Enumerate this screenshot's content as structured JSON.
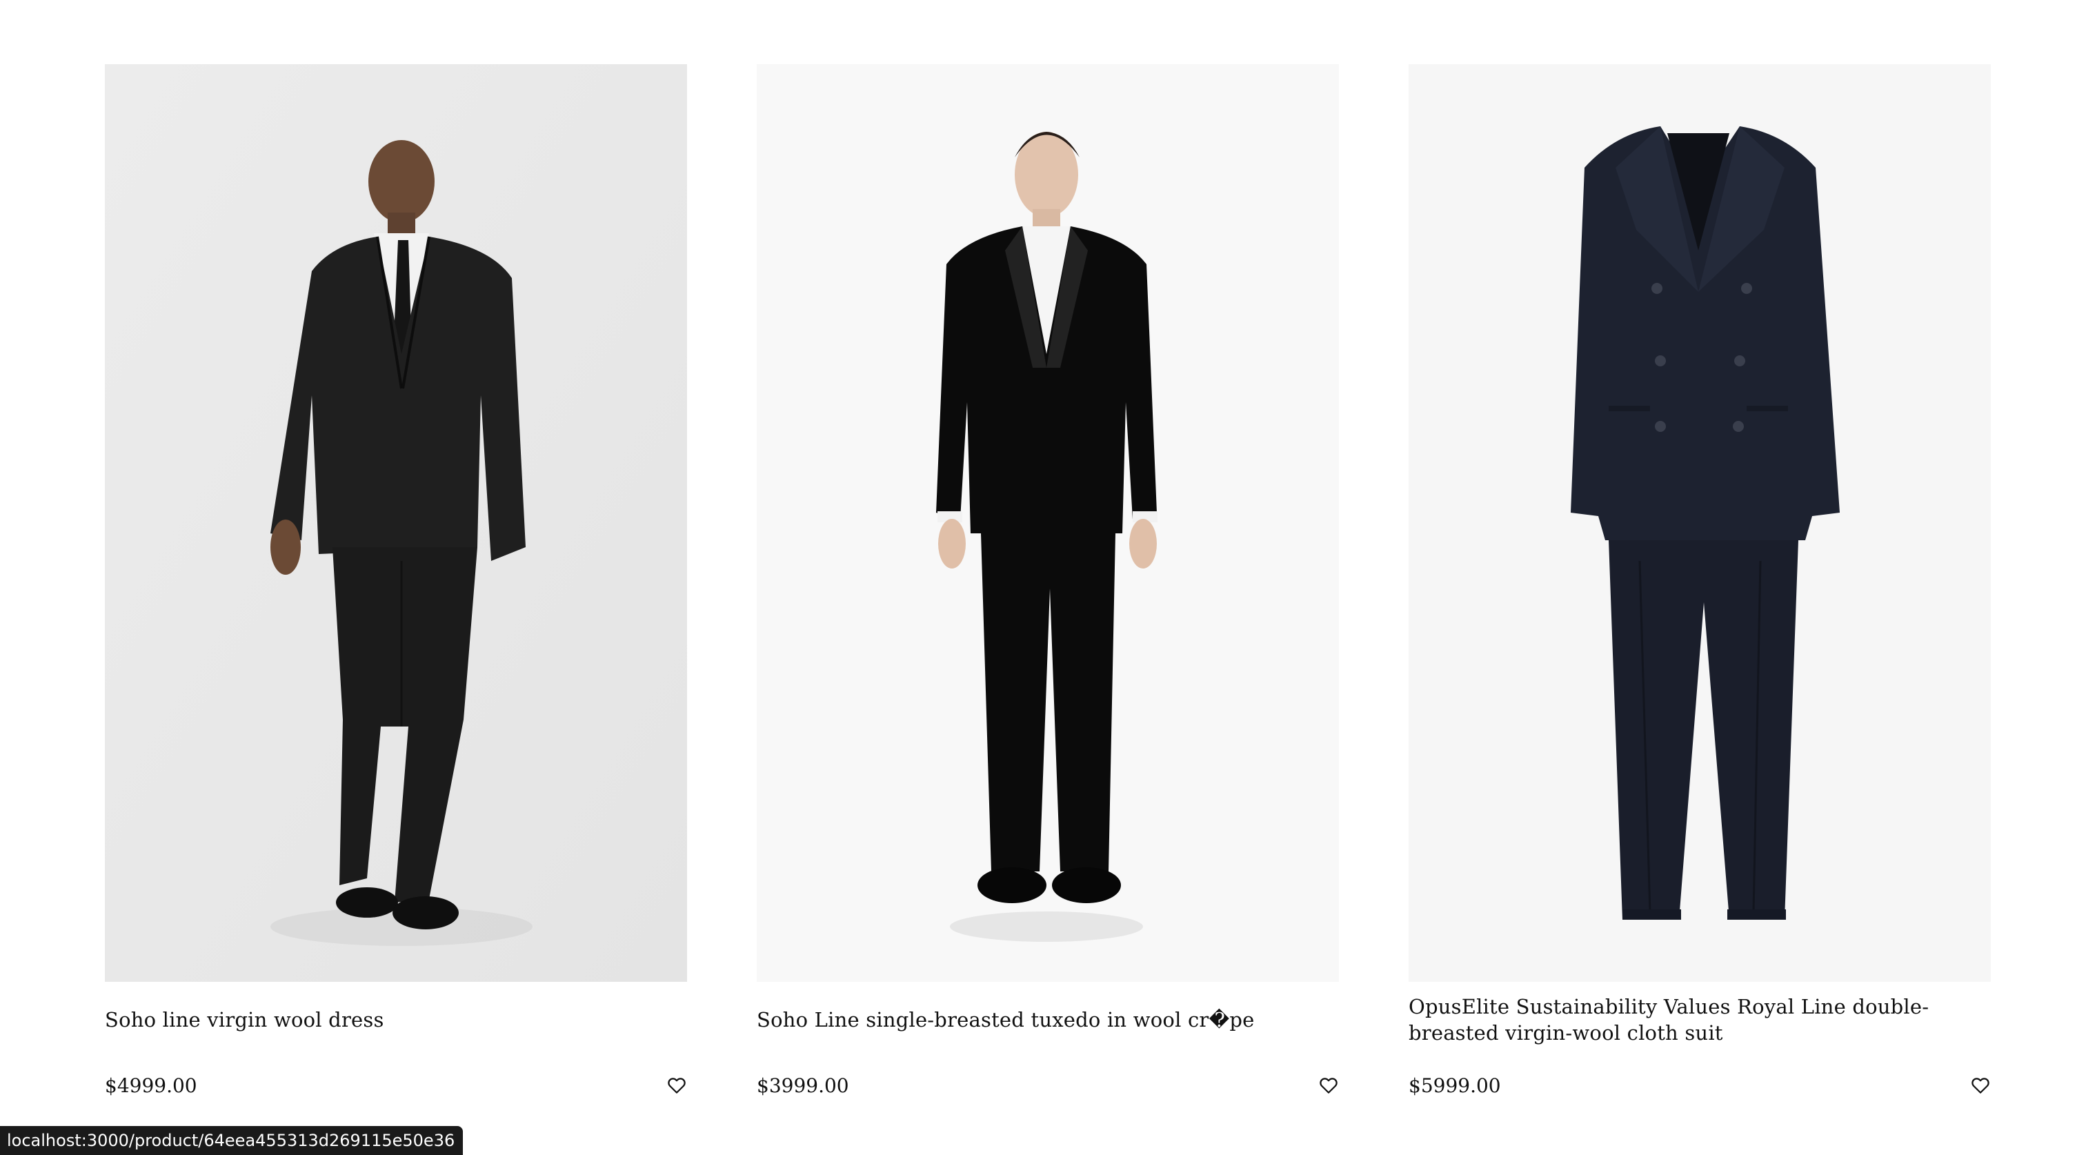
{
  "products": [
    {
      "title": "Soho line virgin wool dress",
      "price": "$4999.00",
      "image_bg": "#ebebeb",
      "icon": "heart-icon"
    },
    {
      "title": "Soho Line single-breasted tuxedo in wool cr�pe",
      "price": "$3999.00",
      "image_bg": "#f7f7f7",
      "icon": "heart-icon"
    },
    {
      "title": "OpusElite Sustainability Values Royal Line double-breasted virgin-wool cloth suit",
      "price": "$5999.00",
      "image_bg": "#f6f6f6",
      "icon": "heart-icon"
    }
  ],
  "status_bar": {
    "url": "localhost:3000/product/64eea455313d269115e50e36"
  }
}
